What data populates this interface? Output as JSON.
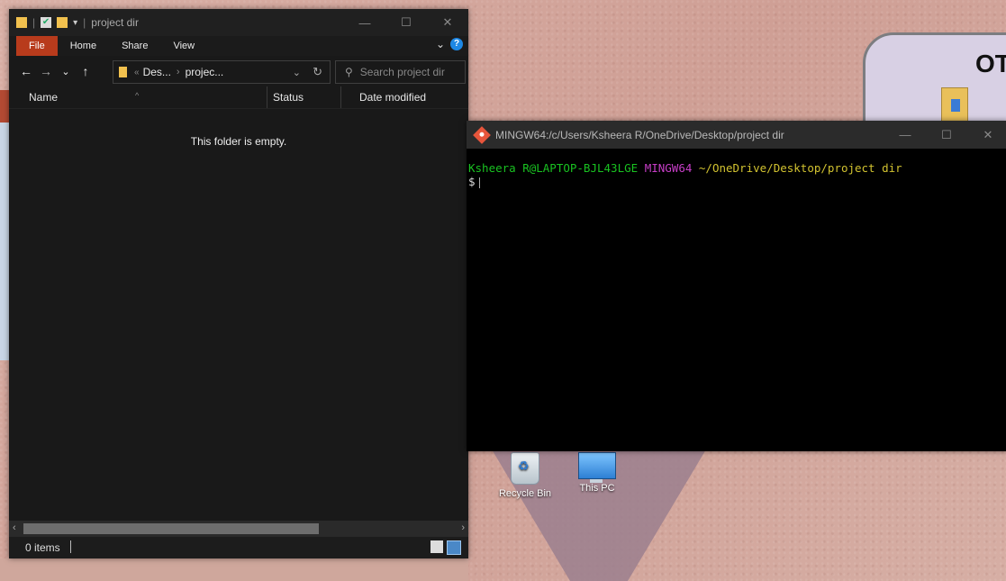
{
  "explorer": {
    "title": "project dir",
    "ribbon_tabs": [
      "File",
      "Home",
      "Share",
      "View"
    ],
    "help": "?",
    "nav": {
      "back": "←",
      "forward": "→",
      "recent": "⌄",
      "up": "↑"
    },
    "address": {
      "prefix": "«",
      "crumbs": [
        "Des...",
        "projec..."
      ],
      "separator": "›"
    },
    "search_placeholder": "Search project dir",
    "columns": [
      "Name",
      "Status",
      "Date modified"
    ],
    "empty_message": "This folder is empty.",
    "status": {
      "item_count": "0 items"
    }
  },
  "terminal": {
    "title": "MINGW64:/c/Users/Ksheera R/OneDrive/Desktop/project dir",
    "prompt": {
      "user_host": "Ksheera R@LAPTOP-BJL43LGE",
      "system": "MINGW64",
      "path": "~/OneDrive/Desktop/project dir",
      "symbol": "$"
    }
  },
  "desktop": {
    "icons": [
      {
        "label": "Recycle Bin",
        "icon": "recycle-bin-icon"
      },
      {
        "label": "This PC",
        "icon": "computer-icon"
      }
    ],
    "partial_window_text": "OT"
  },
  "colors": {
    "file_tab": "#b83b1c",
    "prompt_green": "#19c221",
    "prompt_magenta": "#c73ec7",
    "prompt_yellow": "#d1c230"
  }
}
